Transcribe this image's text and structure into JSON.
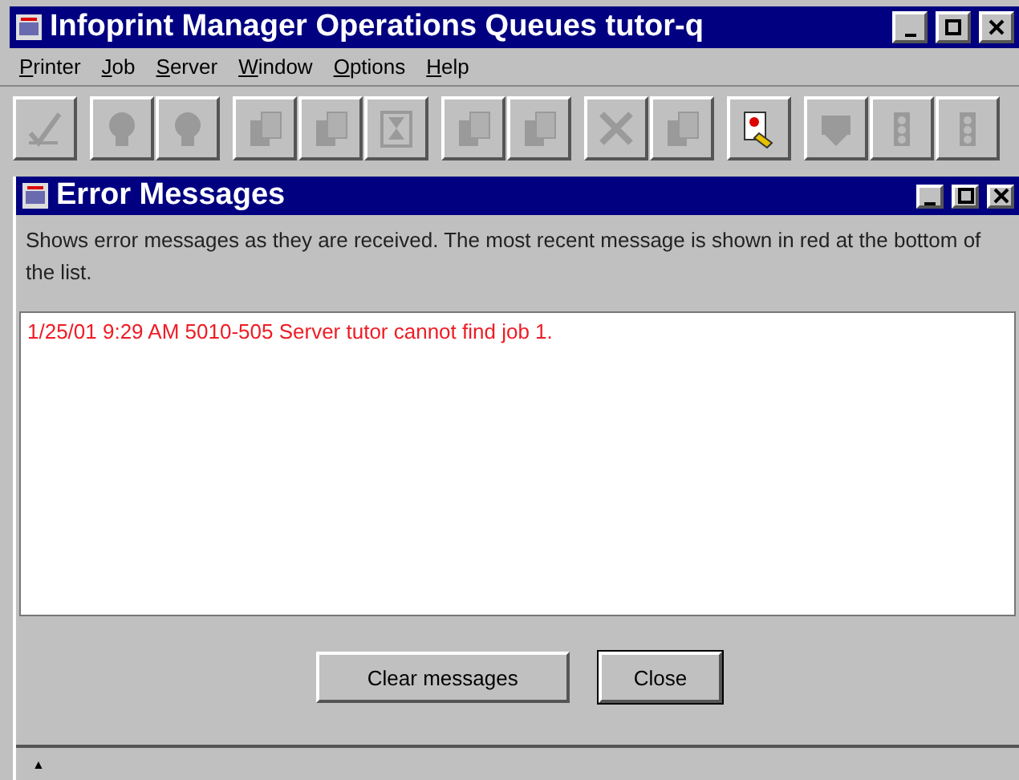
{
  "window": {
    "title": "Infoprint Manager Operations Queues tutor-q"
  },
  "menu": [
    "Printer",
    "Job",
    "Server",
    "Window",
    "Options",
    "Help"
  ],
  "toolbar": [
    [
      {
        "kind": "check",
        "disabled": true
      }
    ],
    [
      {
        "kind": "bulb",
        "disabled": true
      },
      {
        "kind": "bulb",
        "disabled": true
      }
    ],
    [
      {
        "kind": "pages",
        "disabled": true
      },
      {
        "kind": "pages",
        "disabled": true
      },
      {
        "kind": "hourglass",
        "disabled": true
      }
    ],
    [
      {
        "kind": "pages",
        "disabled": true
      },
      {
        "kind": "pages",
        "disabled": true
      }
    ],
    [
      {
        "kind": "cross",
        "disabled": true
      },
      {
        "kind": "pages",
        "disabled": true
      }
    ],
    [
      {
        "kind": "info",
        "disabled": false
      }
    ],
    [
      {
        "kind": "truck",
        "disabled": true
      },
      {
        "kind": "light",
        "disabled": true
      },
      {
        "kind": "light",
        "disabled": true
      }
    ]
  ],
  "dialog": {
    "title": "Error Messages",
    "description": "Shows error messages as they are received. The most recent message is shown in red at the bottom of the list.",
    "messages": [
      {
        "text": "1/25/01 9:29 AM  5010-505 Server tutor cannot find job 1.",
        "recent": true
      }
    ],
    "buttons": [
      {
        "label": "Clear messages",
        "default": false
      },
      {
        "label": "Close",
        "default": true
      }
    ]
  },
  "status_bar": {
    "text": "▲"
  }
}
